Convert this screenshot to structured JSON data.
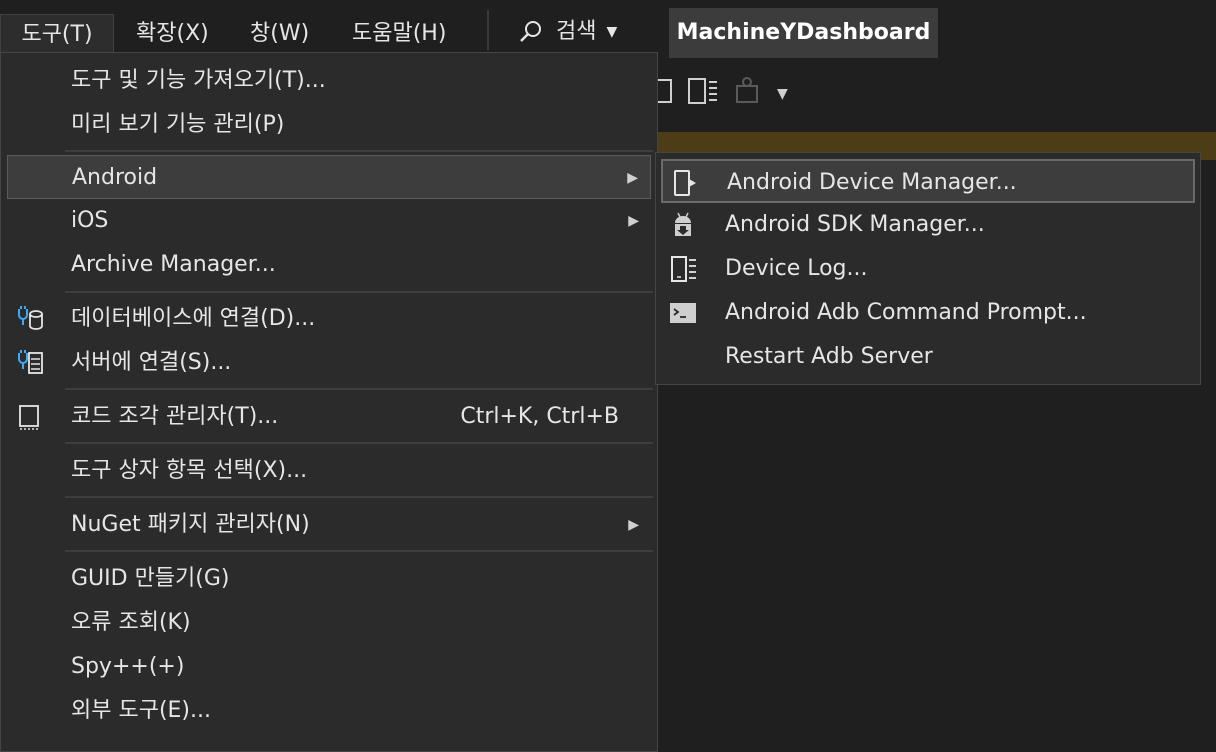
{
  "menubar": {
    "items": [
      "도구(T)",
      "확장(X)",
      "창(W)",
      "도움말(H)"
    ],
    "search_label": "검색",
    "project_title": "MachineYDashboard"
  },
  "tools_menu": {
    "items": [
      {
        "label": "도구 및 기능 가져오기(T)...",
        "icon": null
      },
      {
        "label": "미리 보기 기능 관리(P)",
        "icon": null
      },
      {
        "label": "Android",
        "submenu": true,
        "highlighted": true
      },
      {
        "label": "iOS",
        "submenu": true
      },
      {
        "label": "Archive Manager..."
      },
      {
        "label": "데이터베이스에 연결(D)...",
        "icon": "database-connect-icon"
      },
      {
        "label": "서버에 연결(S)...",
        "icon": "server-connect-icon"
      },
      {
        "label": "코드 조각 관리자(T)...",
        "icon": "snippet-icon",
        "shortcut": "Ctrl+K, Ctrl+B"
      },
      {
        "label": "도구 상자 항목 선택(X)..."
      },
      {
        "label": "NuGet 패키지 관리자(N)",
        "submenu": true
      },
      {
        "label": "GUID 만들기(G)"
      },
      {
        "label": "오류 조회(K)"
      },
      {
        "label": "Spy++(+)"
      },
      {
        "label": "외부 도구(E)..."
      }
    ]
  },
  "android_submenu": {
    "items": [
      {
        "label": "Android Device Manager...",
        "icon": "device-manager-icon",
        "highlighted": true
      },
      {
        "label": "Android SDK Manager...",
        "icon": "android-sdk-icon"
      },
      {
        "label": "Device Log...",
        "icon": "device-log-icon"
      },
      {
        "label": "Android Adb Command Prompt...",
        "icon": "terminal-icon"
      },
      {
        "label": "Restart Adb Server",
        "icon": null
      }
    ]
  },
  "colors": {
    "background": "#1f1f1f",
    "menu_bg": "#2b2b2b",
    "highlight_bg": "#3d3d3d",
    "icon_blue": "#3fa9f5",
    "info_bar": "#4c3d16"
  }
}
